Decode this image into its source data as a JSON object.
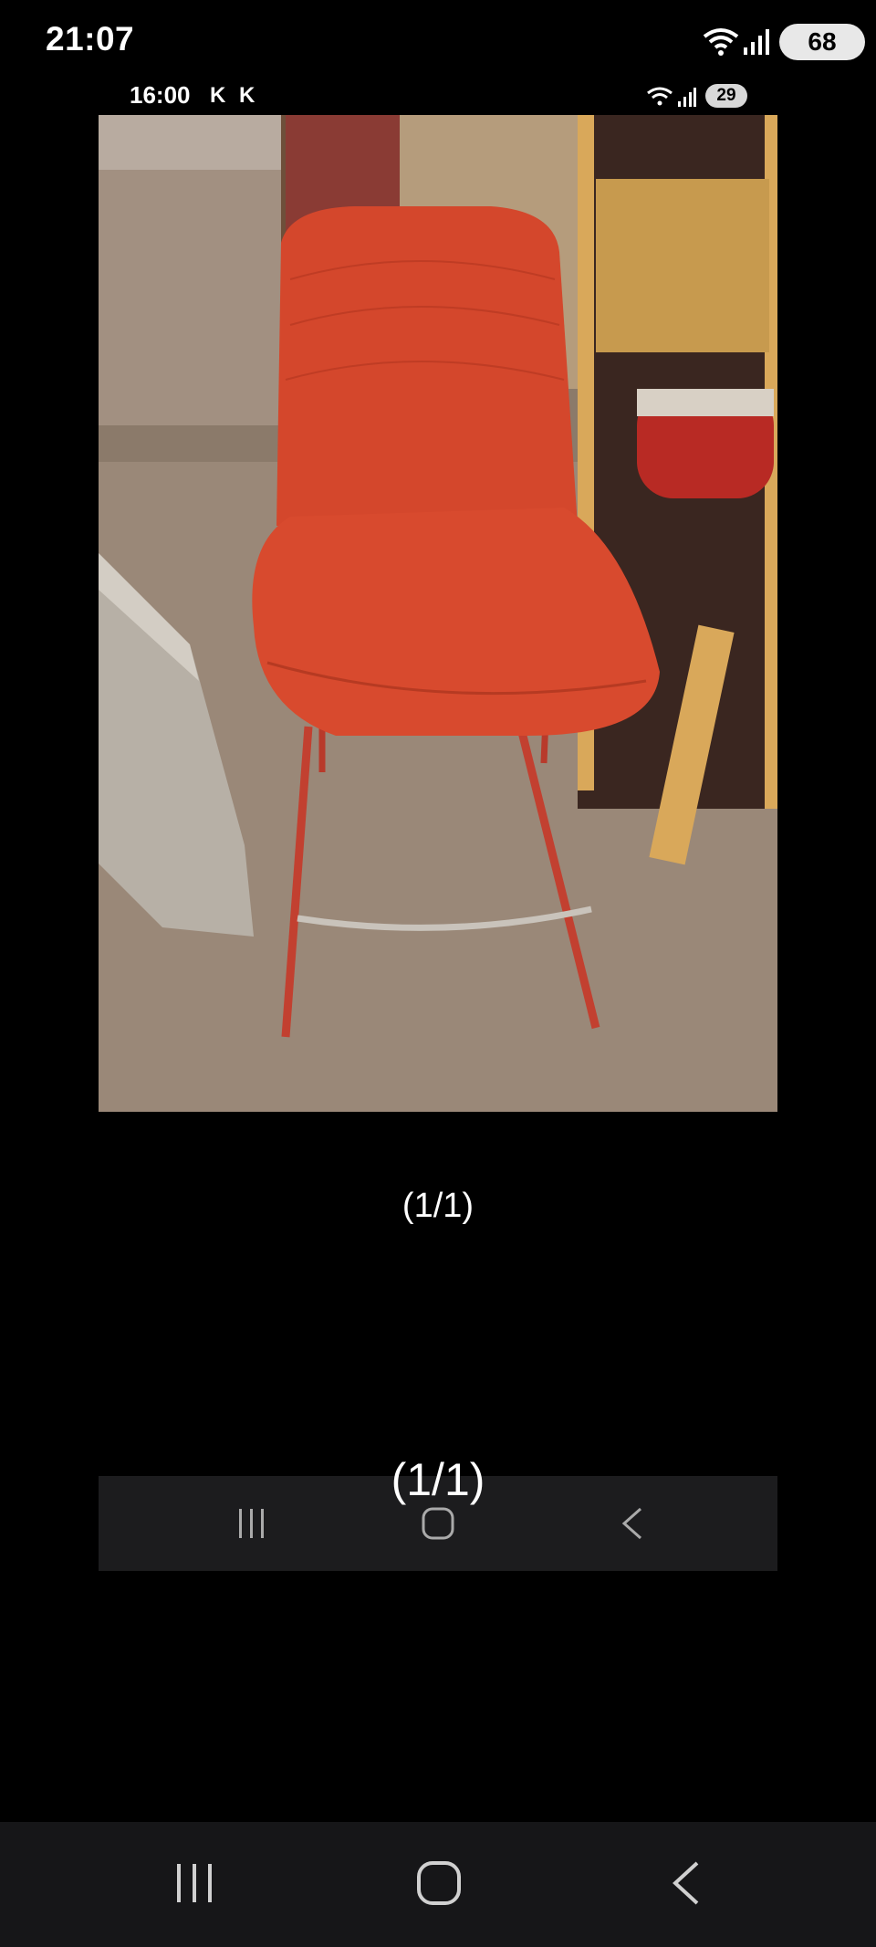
{
  "status_bar": {
    "time": "21:07",
    "battery": "68"
  },
  "inner_status_bar": {
    "time": "16:00",
    "indicator_1": "K",
    "indicator_2": "K",
    "battery": "29"
  },
  "viewer": {
    "image_counter": "(1/1)",
    "image_counter_overlay": "(1/1)"
  },
  "icons": {
    "recents": "recents-icon",
    "home": "home-icon",
    "back": "back-icon"
  },
  "colors": {
    "background": "#000000",
    "nav_bar": "#161618",
    "chair_red": "#d4472c"
  }
}
